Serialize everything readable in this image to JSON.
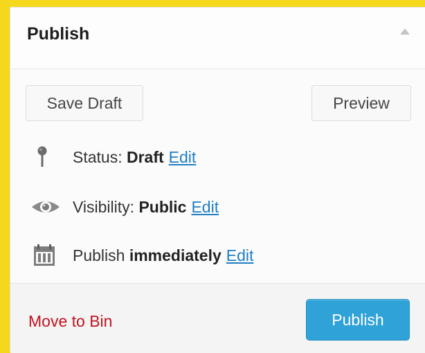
{
  "box": {
    "title": "Publish",
    "toggle_icon": "triangle-up-icon"
  },
  "buttons": {
    "save_draft": "Save Draft",
    "preview": "Preview",
    "publish": "Publish",
    "move_to_bin": "Move to Bin"
  },
  "misc": {
    "status_label": "Status:",
    "status_value": "Draft",
    "visibility_label": "Visibility:",
    "visibility_value": "Public",
    "publish_label": "Publish",
    "publish_value": "immediately",
    "edit": "Edit",
    "status_icon": "pin-icon",
    "visibility_icon": "eye-icon",
    "schedule_icon": "calendar-icon"
  },
  "colors": {
    "accent": "#2fa2d8",
    "link": "#1e7fc4",
    "danger": "#c0131e",
    "frame": "#f5d81c"
  }
}
